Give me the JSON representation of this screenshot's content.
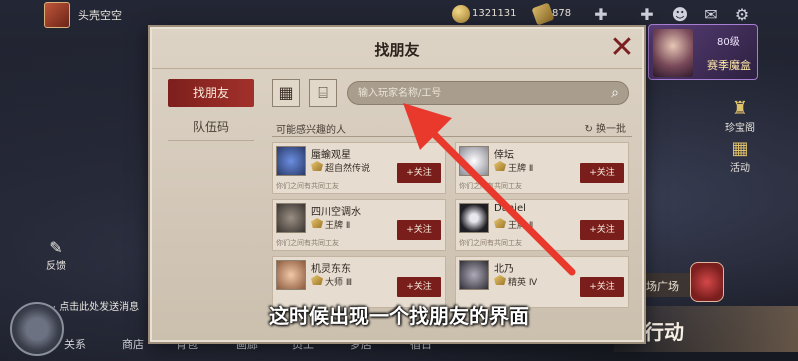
{
  "topbar": {
    "nickname": "头壳空空",
    "currency1": "1321131",
    "currency2": "878",
    "icons": [
      "plus-icon",
      "gamepad-icon",
      "add-friend-icon",
      "mail-icon",
      "gear-icon"
    ]
  },
  "left_hud": {
    "feedback_label": "反馈",
    "chat_hint": "点击此处发送消息"
  },
  "bottom_nav": [
    "关系",
    "商店",
    "背包",
    "画廊",
    "员工",
    "梦店",
    "宿日"
  ],
  "season": {
    "level": "80级",
    "label": "赛季魔盒"
  },
  "right_buttons": [
    {
      "label": "珍宝阁",
      "icon": "treasure-icon"
    },
    {
      "label": "活动",
      "icon": "event-icon"
    }
  ],
  "plaza_label": "场广场",
  "action_label": "行动",
  "dialog": {
    "title": "找朋友",
    "close": "✕",
    "tabs": [
      {
        "label": "找朋友",
        "active": true
      },
      {
        "label": "队伍码",
        "active": false
      }
    ],
    "search_placeholder": "输入玩家名称/工号",
    "list_title": "可能感兴趣的人",
    "refresh_label": "换一批",
    "follow_label": "+关注",
    "cards": [
      {
        "name": "蜃蝓观星",
        "rank": "超自然传说",
        "sub": "你们之间有共同工友",
        "avatar_color": "#2a3a6a"
      },
      {
        "name": "倖坛",
        "rank": "王牌 Ⅱ",
        "sub": "你们之间有共同工友",
        "avatar_color": "#d8d8e0"
      },
      {
        "name": "四川空调水",
        "rank": "王牌 Ⅱ",
        "sub": "你们之间有共同工友",
        "avatar_color": "#4a4440"
      },
      {
        "name": "Daniel",
        "rank": "王牌 Ⅱ",
        "sub": "你们之间有共同工友",
        "avatar_color": "#1e1e24"
      },
      {
        "name": "机灵东东",
        "rank": "大师 Ⅲ",
        "sub": "你们之间有共同工友",
        "avatar_color": "#c9a080"
      },
      {
        "name": "北乃",
        "rank": "精英 Ⅳ",
        "sub": "你们之间有共同工友",
        "avatar_color": "#3a3a44"
      }
    ]
  },
  "subtitle": "这时候出现一个找朋友的界面",
  "colors": {
    "accent": "#7a1e1c",
    "arrow": "#e8392c",
    "panel": "#d6cbbc"
  }
}
